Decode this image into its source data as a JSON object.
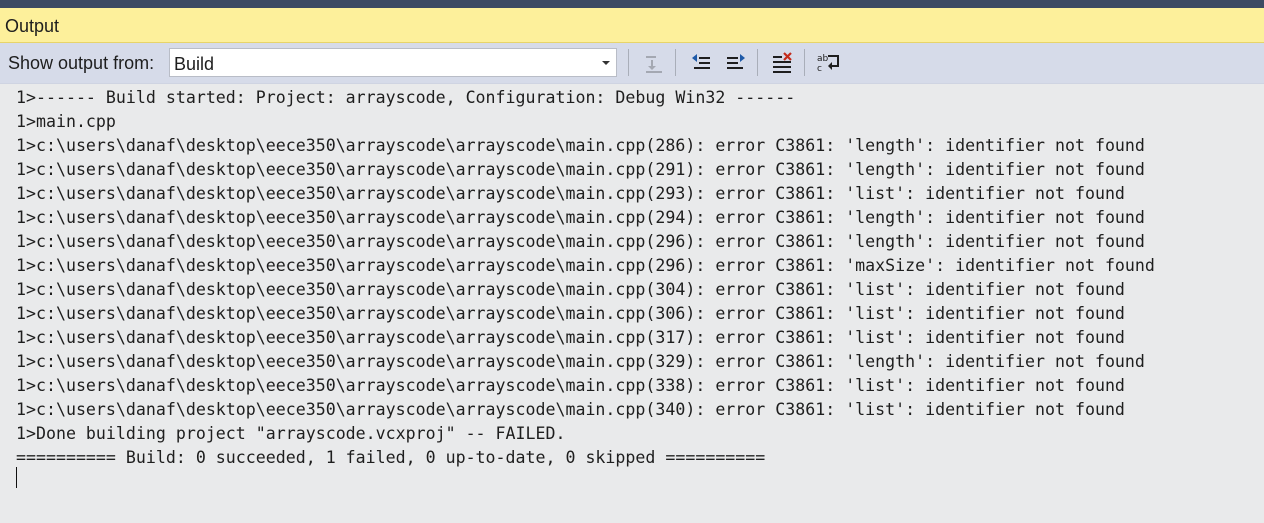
{
  "panel": {
    "title": "Output"
  },
  "toolbar": {
    "show_output_label": "Show output from:",
    "source_selected": "Build",
    "buttons": [
      {
        "icon": "go-to-line-icon",
        "enabled": false
      },
      {
        "icon": "previous-message-icon",
        "enabled": true
      },
      {
        "icon": "next-message-icon",
        "enabled": true
      },
      {
        "icon": "clear-all-icon",
        "enabled": true
      },
      {
        "icon": "word-wrap-icon",
        "enabled": true
      }
    ]
  },
  "output": {
    "lines": [
      "1>------ Build started: Project: arrayscode, Configuration: Debug Win32 ------",
      "1>main.cpp",
      "1>c:\\users\\danaf\\desktop\\eece350\\arrayscode\\arrayscode\\main.cpp(286): error C3861: 'length': identifier not found",
      "1>c:\\users\\danaf\\desktop\\eece350\\arrayscode\\arrayscode\\main.cpp(291): error C3861: 'length': identifier not found",
      "1>c:\\users\\danaf\\desktop\\eece350\\arrayscode\\arrayscode\\main.cpp(293): error C3861: 'list': identifier not found",
      "1>c:\\users\\danaf\\desktop\\eece350\\arrayscode\\arrayscode\\main.cpp(294): error C3861: 'length': identifier not found",
      "1>c:\\users\\danaf\\desktop\\eece350\\arrayscode\\arrayscode\\main.cpp(296): error C3861: 'length': identifier not found",
      "1>c:\\users\\danaf\\desktop\\eece350\\arrayscode\\arrayscode\\main.cpp(296): error C3861: 'maxSize': identifier not found",
      "1>c:\\users\\danaf\\desktop\\eece350\\arrayscode\\arrayscode\\main.cpp(304): error C3861: 'list': identifier not found",
      "1>c:\\users\\danaf\\desktop\\eece350\\arrayscode\\arrayscode\\main.cpp(306): error C3861: 'list': identifier not found",
      "1>c:\\users\\danaf\\desktop\\eece350\\arrayscode\\arrayscode\\main.cpp(317): error C3861: 'list': identifier not found",
      "1>c:\\users\\danaf\\desktop\\eece350\\arrayscode\\arrayscode\\main.cpp(329): error C3861: 'length': identifier not found",
      "1>c:\\users\\danaf\\desktop\\eece350\\arrayscode\\arrayscode\\main.cpp(338): error C3861: 'list': identifier not found",
      "1>c:\\users\\danaf\\desktop\\eece350\\arrayscode\\arrayscode\\main.cpp(340): error C3861: 'list': identifier not found",
      "1>Done building project \"arrayscode.vcxproj\" -- FAILED.",
      "========== Build: 0 succeeded, 1 failed, 0 up-to-date, 0 skipped =========="
    ]
  },
  "colors": {
    "title_bar": "#fdf09b",
    "toolbar": "#d6dbe9",
    "output_bg": "#e9eaeb",
    "top_strip": "#3c4a63",
    "accent_red": "#c42b1c",
    "accent_blue": "#1e5aa8"
  }
}
